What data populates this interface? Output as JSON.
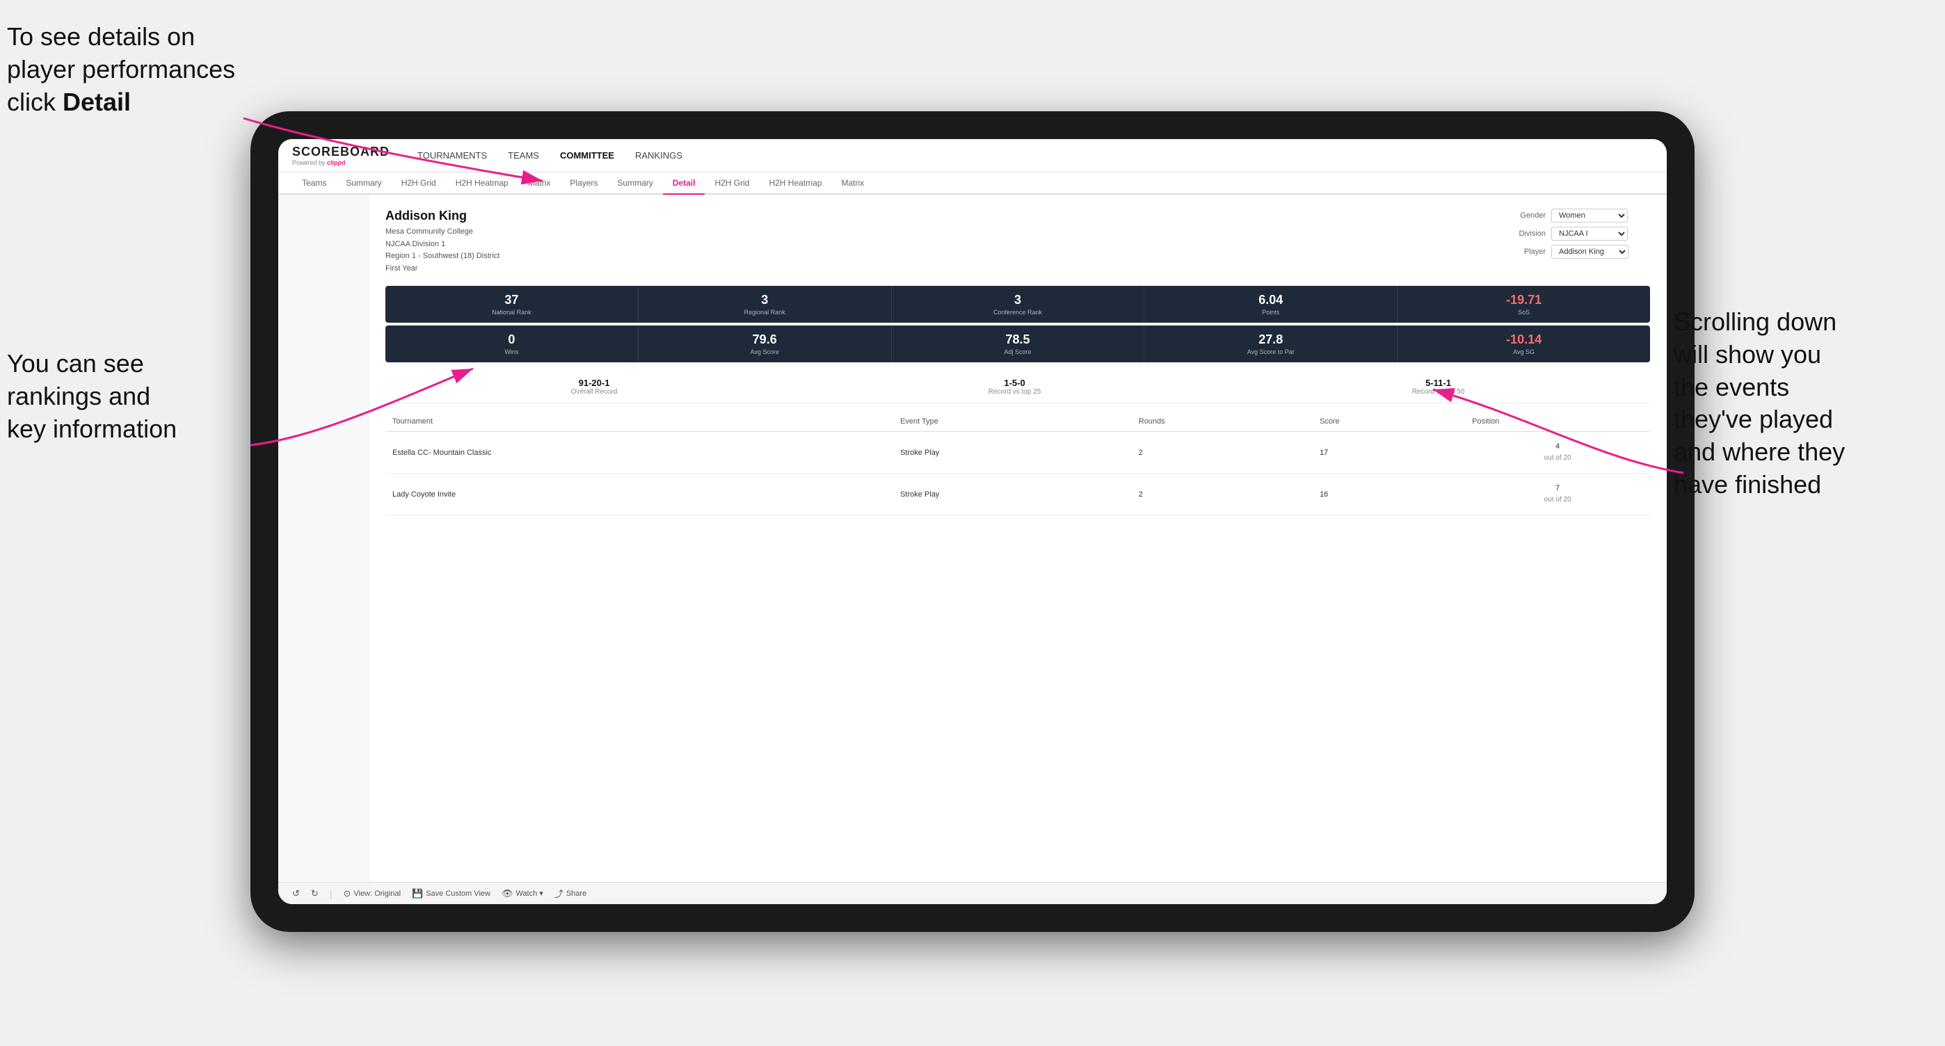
{
  "annotations": {
    "top_left_line1": "To see details on",
    "top_left_line2": "player performances",
    "top_left_line3_pre": "click ",
    "top_left_line3_bold": "Detail",
    "bottom_left_line1": "You can see",
    "bottom_left_line2": "rankings and",
    "bottom_left_line3": "key information",
    "right_line1": "Scrolling down",
    "right_line2": "will show you",
    "right_line3": "the events",
    "right_line4": "they've played",
    "right_line5": "and where they",
    "right_line6": "have finished"
  },
  "nav": {
    "logo": "SCOREBOARD",
    "powered_by": "Powered by",
    "clippd": "clippd",
    "items": [
      "TOURNAMENTS",
      "TEAMS",
      "COMMITTEE",
      "RANKINGS"
    ]
  },
  "sub_nav": {
    "items": [
      "Teams",
      "Summary",
      "H2H Grid",
      "H2H Heatmap",
      "Matrix",
      "Players",
      "Summary",
      "Detail",
      "H2H Grid",
      "H2H Heatmap",
      "Matrix"
    ],
    "active": "Detail"
  },
  "player": {
    "name": "Addison King",
    "college": "Mesa Community College",
    "division": "NJCAA Division 1",
    "region": "Region 1 - Southwest (18) District",
    "year": "First Year",
    "gender_label": "Gender",
    "gender_value": "Women",
    "division_label": "Division",
    "division_value": "NJCAA I",
    "player_label": "Player",
    "player_value": "Addison King"
  },
  "stats_row1": [
    {
      "value": "37",
      "label": "National Rank"
    },
    {
      "value": "3",
      "label": "Regional Rank"
    },
    {
      "value": "3",
      "label": "Conference Rank"
    },
    {
      "value": "6.04",
      "label": "Points"
    },
    {
      "value": "-19.71",
      "label": "SoS",
      "negative": true
    }
  ],
  "stats_row2": [
    {
      "value": "0",
      "label": "Wins"
    },
    {
      "value": "79.6",
      "label": "Avg Score"
    },
    {
      "value": "78.5",
      "label": "Adj Score"
    },
    {
      "value": "27.8",
      "label": "Avg Score to Par"
    },
    {
      "value": "-10.14",
      "label": "Avg SG",
      "negative": true
    }
  ],
  "records": [
    {
      "value": "91-20-1",
      "label": "Overall Record"
    },
    {
      "value": "1-5-0",
      "label": "Record vs top 25"
    },
    {
      "value": "5-11-1",
      "label": "Record vs top 50"
    }
  ],
  "table": {
    "headers": [
      "Tournament",
      "Event Type",
      "Rounds",
      "Score",
      "Position"
    ],
    "rows": [
      {
        "tournament": "Estella CC- Mountain Classic",
        "event_type": "Stroke Play",
        "rounds": "2",
        "score": "17",
        "position": "4",
        "position_sub": "out of 20"
      },
      {
        "tournament": "Lady Coyote Invite",
        "event_type": "Stroke Play",
        "rounds": "2",
        "score": "16",
        "position": "7",
        "position_sub": "out of 20"
      }
    ]
  },
  "toolbar": {
    "items": [
      "View: Original",
      "Save Custom View",
      "Watch",
      "Share"
    ]
  }
}
